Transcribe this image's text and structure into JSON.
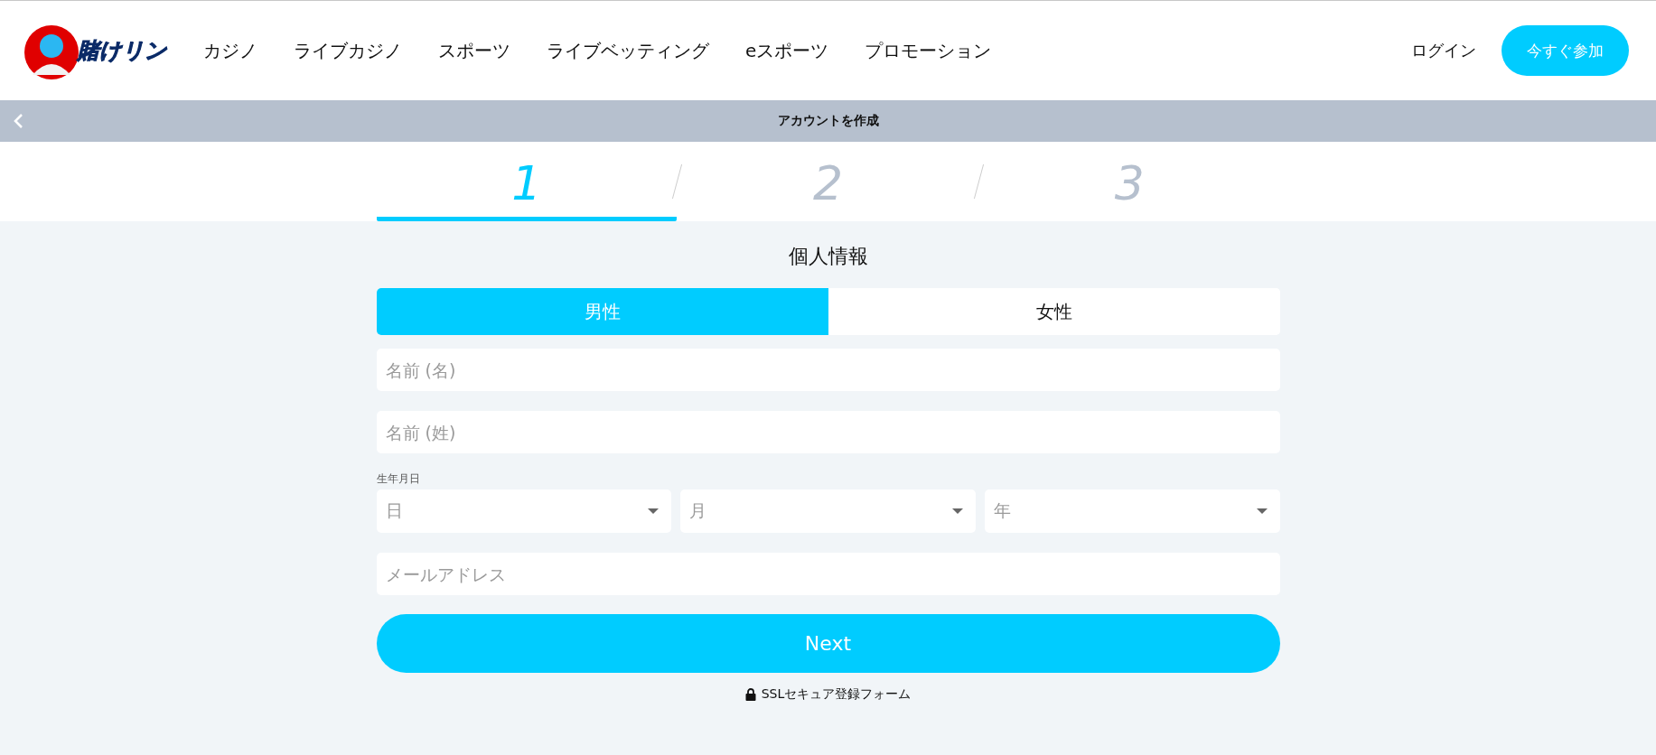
{
  "header": {
    "logo_text": "賭けリン",
    "nav": [
      {
        "label": "カジノ"
      },
      {
        "label": "ライブカジノ"
      },
      {
        "label": "スポーツ"
      },
      {
        "label": "ライブベッティング"
      },
      {
        "label": "eスポーツ"
      },
      {
        "label": "プロモーション"
      }
    ],
    "login": "ログイン",
    "join": "今すぐ参加"
  },
  "title_bar": {
    "title": "アカウントを作成"
  },
  "steps": [
    {
      "label": "1",
      "selected": true
    },
    {
      "label": "2",
      "selected": false
    },
    {
      "label": "3",
      "selected": false
    }
  ],
  "form": {
    "heading": "個人情報",
    "gender": [
      {
        "label": "男性",
        "selected": true
      },
      {
        "label": "女性",
        "selected": false
      }
    ],
    "first_name": {
      "placeholder": "名前 (名)"
    },
    "last_name": {
      "placeholder": "名前 (姓)"
    },
    "birth_label": "生年月日",
    "birth": [
      {
        "placeholder": "日"
      },
      {
        "placeholder": "月"
      },
      {
        "placeholder": "年"
      }
    ],
    "email": {
      "placeholder": "メールアドレス"
    },
    "next": "Next",
    "ssl_note": "SSLセキュア登録フォーム"
  }
}
